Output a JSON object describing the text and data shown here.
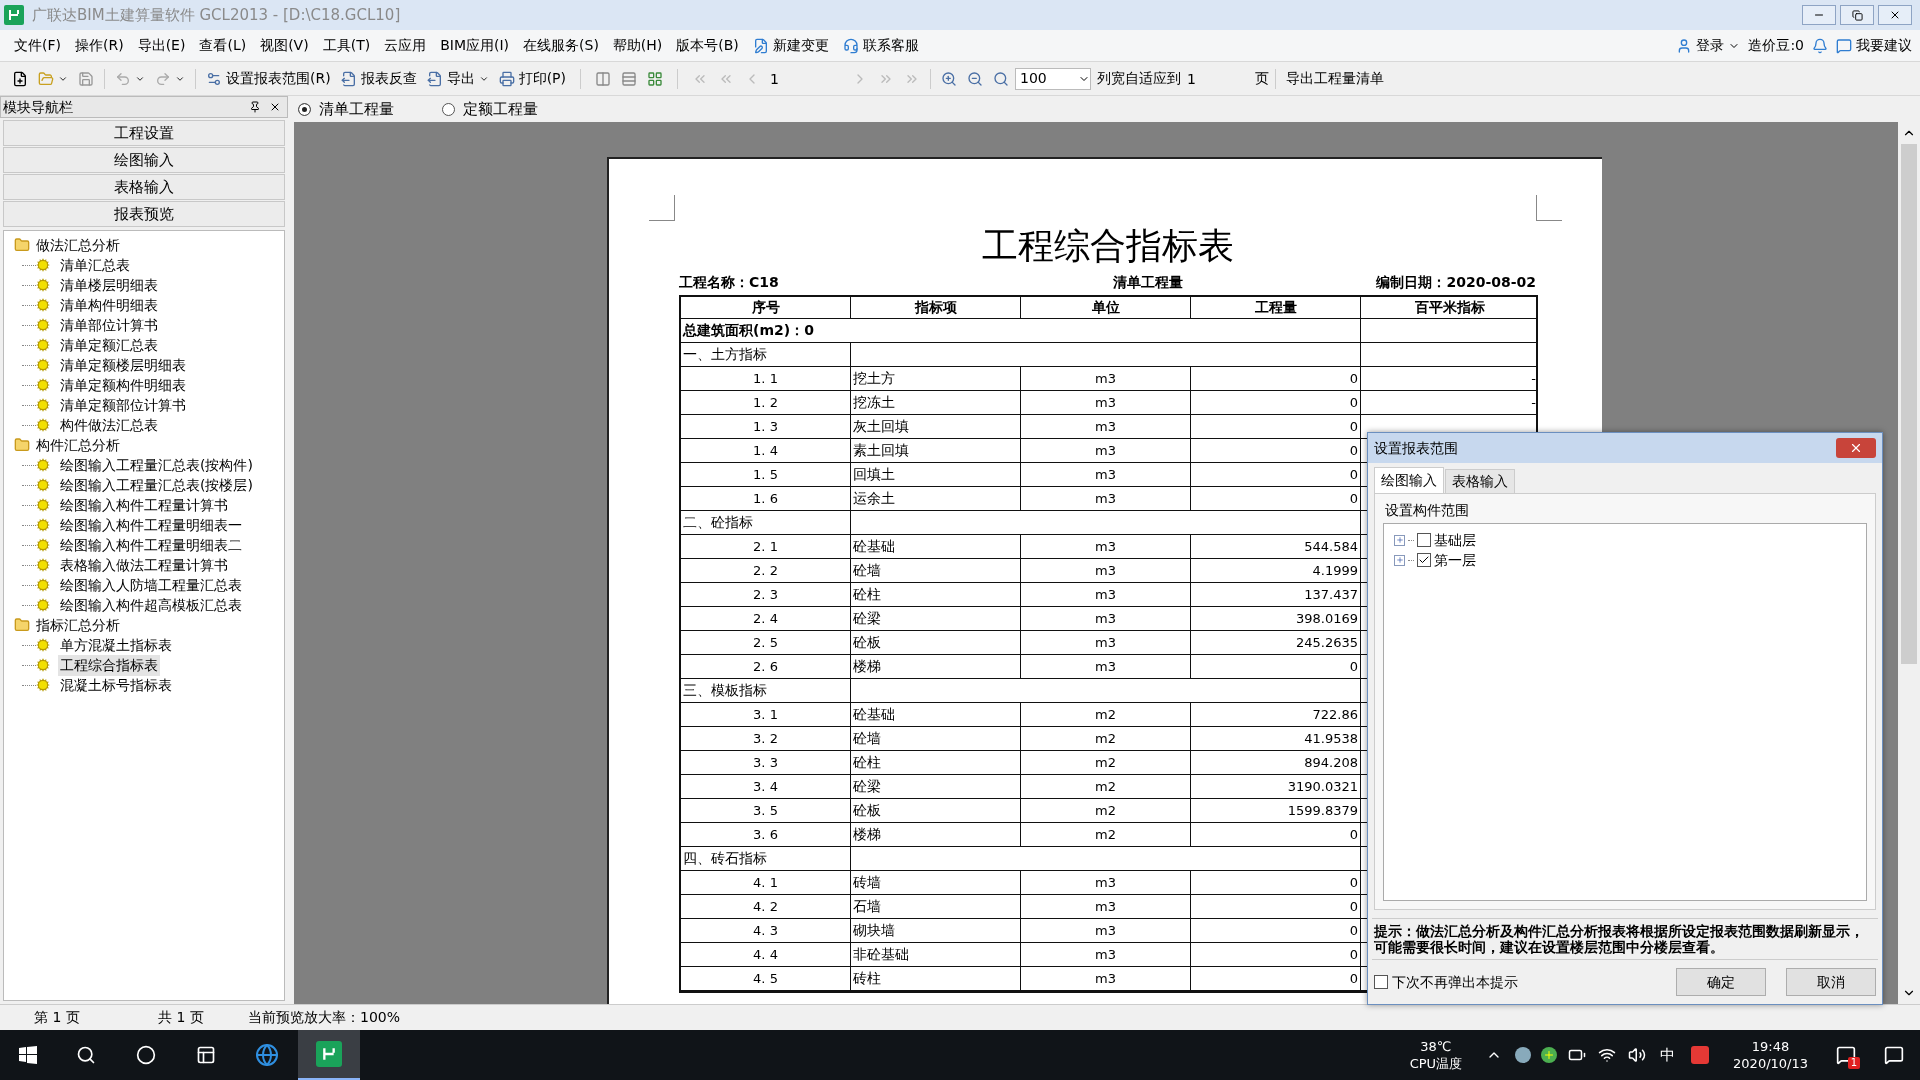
{
  "window": {
    "title": "广联达BIM土建算量软件 GCL2013 - [D:\\C18.GCL10]"
  },
  "menu": {
    "items": [
      "文件(F)",
      "操作(R)",
      "导出(E)",
      "查看(L)",
      "视图(V)",
      "工具(T)",
      "云应用",
      "BIM应用(I)",
      "在线服务(S)",
      "帮助(H)",
      "版本号(B)"
    ],
    "actions": [
      "新建变更",
      "联系客服"
    ],
    "right": [
      "登录",
      "造价豆:0",
      "我要建议"
    ]
  },
  "toolbar": {
    "buttons": [
      "设置报表范围(R)",
      "报表反查",
      "导出",
      "打印(P)"
    ],
    "page_field": "1",
    "zoom_value": "100",
    "fit_label": "列宽自适应到",
    "fit_value": "1",
    "fit_unit": "页",
    "export_list": "导出工程量清单"
  },
  "nav": {
    "title": "模块导航栏",
    "modules": [
      "工程设置",
      "绘图输入",
      "表格输入",
      "报表预览"
    ],
    "tree": [
      {
        "label": "做法汇总分析",
        "children": [
          {
            "label": "清单汇总表",
            "selected": false
          },
          {
            "label": "清单楼层明细表",
            "selected": false
          },
          {
            "label": "清单构件明细表",
            "selected": false
          },
          {
            "label": "清单部位计算书",
            "selected": false
          },
          {
            "label": "清单定额汇总表",
            "selected": false
          },
          {
            "label": "清单定额楼层明细表",
            "selected": false
          },
          {
            "label": "清单定额构件明细表",
            "selected": false
          },
          {
            "label": "清单定额部位计算书",
            "selected": false
          },
          {
            "label": "构件做法汇总表",
            "selected": false
          }
        ]
      },
      {
        "label": "构件汇总分析",
        "children": [
          {
            "label": "绘图输入工程量汇总表(按构件)",
            "selected": false
          },
          {
            "label": "绘图输入工程量汇总表(按楼层)",
            "selected": false
          },
          {
            "label": "绘图输入构件工程量计算书",
            "selected": false
          },
          {
            "label": "绘图输入构件工程量明细表一",
            "selected": false
          },
          {
            "label": "绘图输入构件工程量明细表二",
            "selected": false
          },
          {
            "label": "表格输入做法工程量计算书",
            "selected": false
          },
          {
            "label": "绘图输入人防墙工程量汇总表",
            "selected": false
          },
          {
            "label": "绘图输入构件超高模板汇总表",
            "selected": false
          }
        ]
      },
      {
        "label": "指标汇总分析",
        "children": [
          {
            "label": "单方混凝土指标表",
            "selected": false
          },
          {
            "label": "工程综合指标表",
            "selected": true
          },
          {
            "label": "混凝土标号指标表",
            "selected": false
          }
        ]
      }
    ]
  },
  "mode_options": [
    {
      "label": "清单工程量",
      "selected": true
    },
    {
      "label": "定额工程量",
      "selected": false
    }
  ],
  "report": {
    "title": "工程综合指标表",
    "project": "工程名称：C18",
    "subtitle": "清单工程量",
    "date": "编制日期：2020-08-02",
    "columns": [
      "序号",
      "指标项",
      "单位",
      "工程量",
      "百平米指标"
    ],
    "rows": [
      {
        "kind": "total",
        "text": "总建筑面积(m2)：0"
      },
      {
        "kind": "section",
        "text": "一、土方指标"
      },
      {
        "kind": "item",
        "no": "1. 1",
        "name": "挖土方",
        "unit": "m3",
        "qty": "0",
        "index": "-"
      },
      {
        "kind": "item",
        "no": "1. 2",
        "name": "挖冻土",
        "unit": "m3",
        "qty": "0",
        "index": "-"
      },
      {
        "kind": "item",
        "no": "1. 3",
        "name": "灰土回填",
        "unit": "m3",
        "qty": "0"
      },
      {
        "kind": "item",
        "no": "1. 4",
        "name": "素土回填",
        "unit": "m3",
        "qty": "0"
      },
      {
        "kind": "item",
        "no": "1. 5",
        "name": "回填土",
        "unit": "m3",
        "qty": "0"
      },
      {
        "kind": "item",
        "no": "1. 6",
        "name": "运余土",
        "unit": "m3",
        "qty": "0"
      },
      {
        "kind": "section",
        "text": "二、砼指标"
      },
      {
        "kind": "item",
        "no": "2. 1",
        "name": "砼基础",
        "unit": "m3",
        "qty": "544.584"
      },
      {
        "kind": "item",
        "no": "2. 2",
        "name": "砼墙",
        "unit": "m3",
        "qty": "4.1999"
      },
      {
        "kind": "item",
        "no": "2. 3",
        "name": "砼柱",
        "unit": "m3",
        "qty": "137.437"
      },
      {
        "kind": "item",
        "no": "2. 4",
        "name": "砼梁",
        "unit": "m3",
        "qty": "398.0169"
      },
      {
        "kind": "item",
        "no": "2. 5",
        "name": "砼板",
        "unit": "m3",
        "qty": "245.2635"
      },
      {
        "kind": "item",
        "no": "2. 6",
        "name": "楼梯",
        "unit": "m3",
        "qty": "0"
      },
      {
        "kind": "section",
        "text": "三、模板指标"
      },
      {
        "kind": "item",
        "no": "3. 1",
        "name": "砼基础",
        "unit": "m2",
        "qty": "722.86"
      },
      {
        "kind": "item",
        "no": "3. 2",
        "name": "砼墙",
        "unit": "m2",
        "qty": "41.9538"
      },
      {
        "kind": "item",
        "no": "3. 3",
        "name": "砼柱",
        "unit": "m2",
        "qty": "894.208"
      },
      {
        "kind": "item",
        "no": "3. 4",
        "name": "砼梁",
        "unit": "m2",
        "qty": "3190.0321"
      },
      {
        "kind": "item",
        "no": "3. 5",
        "name": "砼板",
        "unit": "m2",
        "qty": "1599.8379"
      },
      {
        "kind": "item",
        "no": "3. 6",
        "name": "楼梯",
        "unit": "m2",
        "qty": "0"
      },
      {
        "kind": "section",
        "text": "四、砖石指标"
      },
      {
        "kind": "item",
        "no": "4. 1",
        "name": "砖墙",
        "unit": "m3",
        "qty": "0"
      },
      {
        "kind": "item",
        "no": "4. 2",
        "name": "石墙",
        "unit": "m3",
        "qty": "0"
      },
      {
        "kind": "item",
        "no": "4. 3",
        "name": "砌块墙",
        "unit": "m3",
        "qty": "0"
      },
      {
        "kind": "item",
        "no": "4. 4",
        "name": "非砼基础",
        "unit": "m3",
        "qty": "0"
      },
      {
        "kind": "item",
        "no": "4. 5",
        "name": "砖柱",
        "unit": "m3",
        "qty": "0"
      }
    ]
  },
  "dialog": {
    "title": "设置报表范围",
    "tabs": [
      {
        "label": "绘图输入",
        "selected": true
      },
      {
        "label": "表格输入",
        "selected": false
      }
    ],
    "group": "设置构件范围",
    "floors": [
      {
        "label": "基础层",
        "checked": false
      },
      {
        "label": "第一层",
        "checked": true
      }
    ],
    "hint": "提示：做法汇总分析及构件汇总分析报表将根据所设定报表范围数据刷新显示，可能需要很长时间，建议在设置楼层范围中分楼层查看。",
    "dont_show": {
      "label": "下次不再弹出本提示",
      "checked": false
    },
    "buttons": [
      "确定",
      "取消"
    ]
  },
  "status_bar": [
    "第 1 页",
    "共 1 页",
    "当前预览放大率：100%"
  ],
  "taskbar": {
    "temp": "38℃",
    "temp_label": "CPU温度",
    "ime": "中",
    "time": "19:48",
    "date": "2020/10/13",
    "badge": "1"
  }
}
